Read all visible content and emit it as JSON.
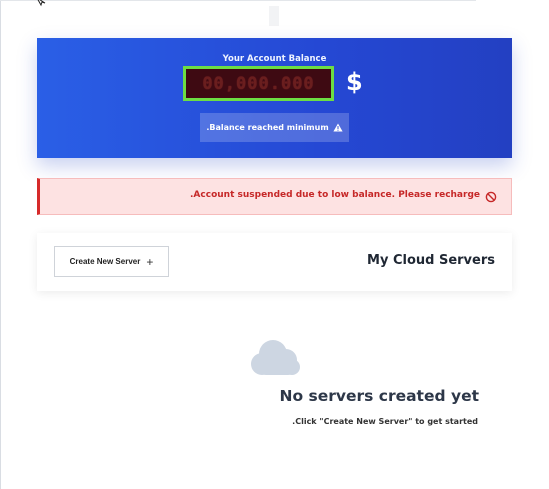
{
  "balance": {
    "title": "Your Account Balance",
    "value": "00,000.000",
    "currency_symbol": "$",
    "status_label": ".Balance reached minimum"
  },
  "alert": {
    "message": ".Account suspended due to low balance. Please recharge",
    "icon": "ban-icon"
  },
  "servers": {
    "title": "My Cloud Servers",
    "create_button_label": "Create New Server",
    "create_button_icon": "plus-icon"
  },
  "empty_state": {
    "icon": "cloud-icon",
    "title": "No servers created yet",
    "subtitle": ".Click \"Create New Server\" to get started"
  },
  "colors": {
    "balance_gradient_start": "#2a5fe6",
    "balance_gradient_end": "#2340c2",
    "balance_box_bg": "#3e0a12",
    "balance_box_border": "#6dde43",
    "alert_bg": "#fde2e2",
    "alert_accent": "#d62a2a",
    "cloud_icon": "#cdd6e2"
  }
}
